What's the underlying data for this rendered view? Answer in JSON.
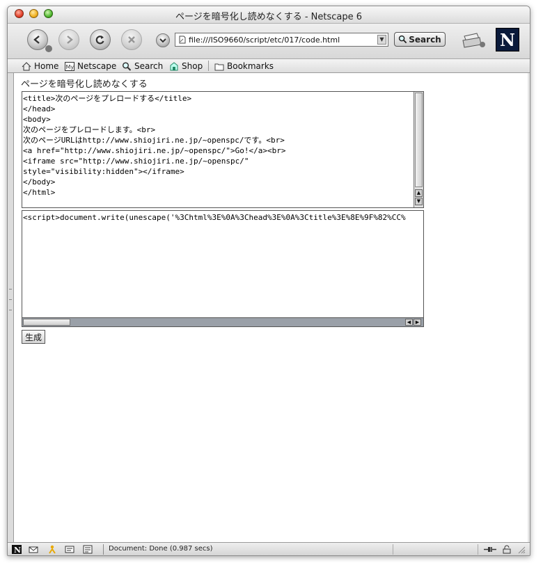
{
  "window": {
    "title": "ページを暗号化し読めなくする - Netscape 6"
  },
  "navbar": {
    "url": "file:///ISO9660/script/etc/017/code.html",
    "search_label": "Search",
    "logo_letter": "N"
  },
  "personal_toolbar": {
    "items": [
      {
        "label": "Home",
        "icon": "home-icon"
      },
      {
        "label": "Netscape",
        "icon": "my-netscape-icon"
      },
      {
        "label": "Search",
        "icon": "magnifier-icon"
      },
      {
        "label": "Shop",
        "icon": "shop-icon"
      },
      {
        "label": "Bookmarks",
        "icon": "folder-icon"
      }
    ]
  },
  "page": {
    "heading": "ページを暗号化し読めなくする",
    "source_text": "<title>次のページをプレロードする</title>\n</head>\n<body>\n次のページをプレロードします。<br>\n次のページURLはhttp://www.shiojiri.ne.jp/~openspc/です。<br>\n<a href=\"http://www.shiojiri.ne.jp/~openspc/\">Go!</a><br>\n<iframe src=\"http://www.shiojiri.ne.jp/~openspc/\"\nstyle=\"visibility:hidden\"></iframe>\n</body>\n</html>",
    "output_text": "<script>document.write(unescape('%3Chtml%3E%0A%3Chead%3E%0A%3Ctitle%3E%8E%9F%82%CC%",
    "generate_label": "生成"
  },
  "statusbar": {
    "text": "Document: Done (0.987 secs)"
  }
}
